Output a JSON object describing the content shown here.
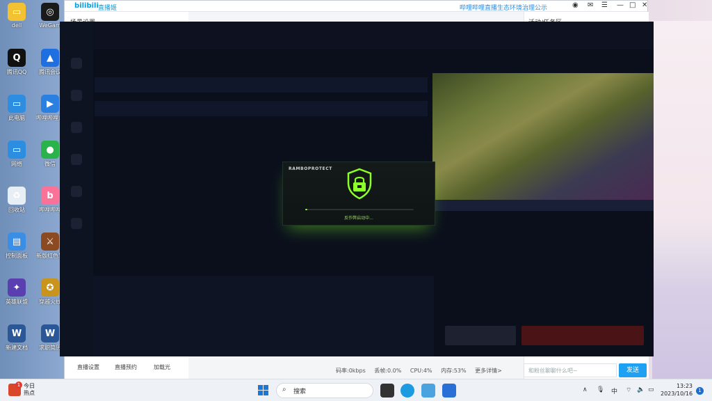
{
  "desktop": {
    "icons": [
      {
        "label": "dell",
        "col": 0,
        "row": 0,
        "color": "#f3c233",
        "glyph": "▭"
      },
      {
        "label": "WeGam",
        "col": 1,
        "row": 0,
        "color": "#1a1a1a",
        "glyph": "◎"
      },
      {
        "label": "腾讯QQ",
        "col": 0,
        "row": 1,
        "color": "#111",
        "glyph": "Q"
      },
      {
        "label": "腾讯会议",
        "col": 1,
        "row": 1,
        "color": "#1f6fe0",
        "glyph": "▲"
      },
      {
        "label": "此电脑",
        "col": 0,
        "row": 2,
        "color": "#2d8de0",
        "glyph": "▭"
      },
      {
        "label": "哔哩哔哩直播姬",
        "col": 1,
        "row": 2,
        "color": "#2a7fe0",
        "glyph": "▶"
      },
      {
        "label": "网络",
        "col": 0,
        "row": 3,
        "color": "#2d8de0",
        "glyph": "▭"
      },
      {
        "label": "微信",
        "col": 1,
        "row": 3,
        "color": "#2ab24b",
        "glyph": "●"
      },
      {
        "label": "回收站",
        "col": 0,
        "row": 4,
        "color": "#e8eef5",
        "glyph": "♻"
      },
      {
        "label": "哔哩哔哩",
        "col": 1,
        "row": 4,
        "color": "#fb7299",
        "glyph": "b"
      },
      {
        "label": "控制面板",
        "col": 0,
        "row": 5,
        "color": "#3a8ee6",
        "glyph": "▤"
      },
      {
        "label": "新版红色警戒",
        "col": 1,
        "row": 5,
        "color": "#8b4a22",
        "glyph": "⚔"
      },
      {
        "label": "英雄联盟",
        "col": 0,
        "row": 6,
        "color": "#5a3fb0",
        "glyph": "✦"
      },
      {
        "label": "穿越火线",
        "col": 1,
        "row": 6,
        "color": "#c8941c",
        "glyph": "✪"
      },
      {
        "label": "新建文档",
        "col": 0,
        "row": 7,
        "color": "#2b5797",
        "glyph": "W"
      },
      {
        "label": "求职简历",
        "col": 1,
        "row": 7,
        "color": "#2b5797",
        "glyph": "W"
      }
    ]
  },
  "window": {
    "brand": "bilibili",
    "brand_sub": "直播姬",
    "notice": "哔哩哔哩直播生态环境治理公示",
    "left_panel_title": "场景设置",
    "right_panel_title": "活动/任务区",
    "bottom_nav": [
      "直播设置",
      "直播预约",
      "加载光"
    ],
    "status": {
      "bitrate": "码率:0kbps",
      "drop": "丢帧:0.0%",
      "cpu": "CPU:4%",
      "memory": "内存:53%",
      "more": "更多详情>"
    },
    "chat_placeholder": "和粉丝聊聊什么吧~",
    "send": "发送"
  },
  "dialog": {
    "title": "RAMBOPROTECT",
    "status": "反作弊启动中...",
    "progress": 0.02,
    "accent": "#8cff2a"
  },
  "taskbar": {
    "search_placeholder": "搜索",
    "news_badge": "1",
    "news_line1": "今日",
    "news_line2": "热点",
    "ime": "中",
    "time": "13:23",
    "date": "2023/10/16",
    "notif_count": "1"
  }
}
